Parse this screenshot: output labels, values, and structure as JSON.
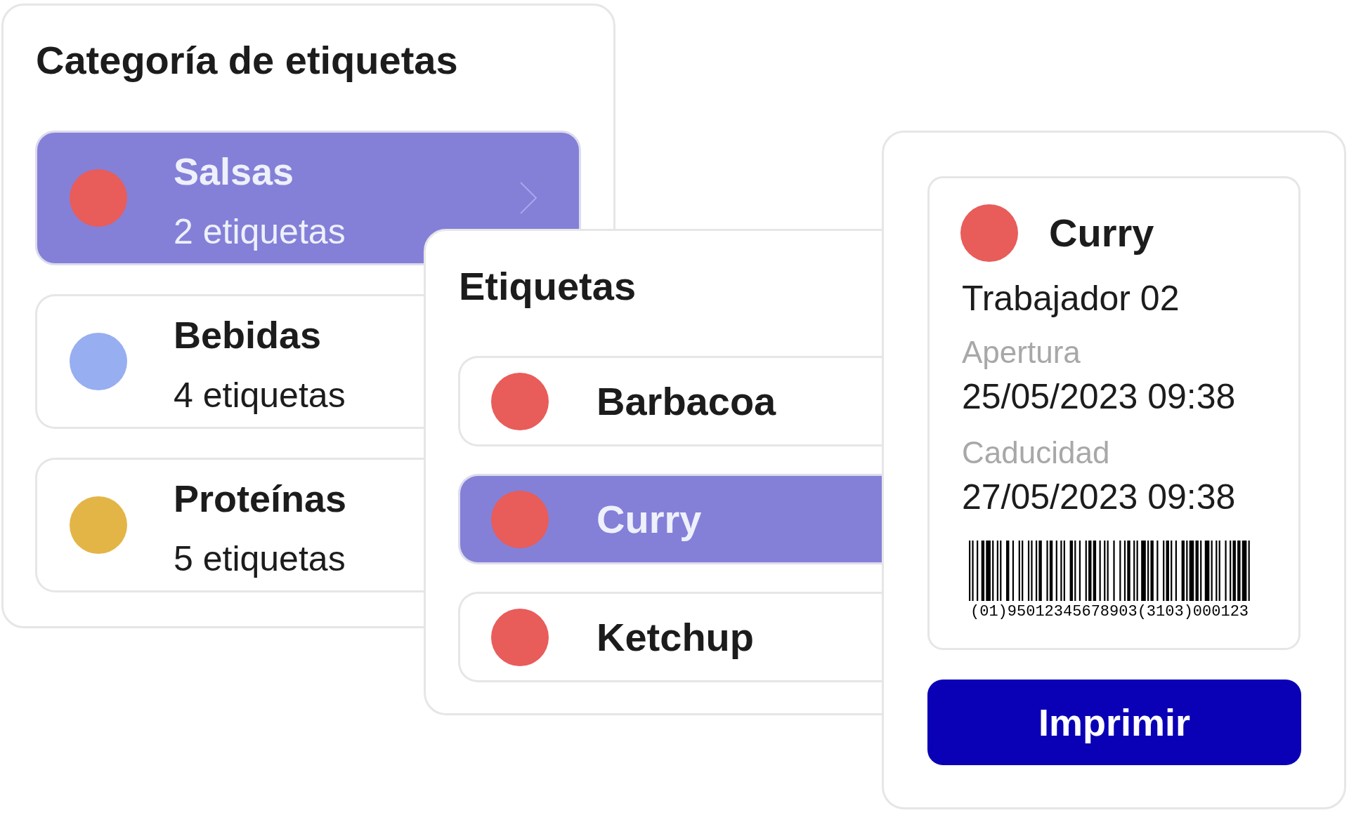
{
  "categories_panel": {
    "title": "Categoría de etiquetas",
    "items": [
      {
        "name": "Salsas",
        "count": "2 etiquetas",
        "color": "#e85c5a",
        "selected": true
      },
      {
        "name": "Bebidas",
        "count": "4 etiquetas",
        "color": "#97aef0",
        "selected": false
      },
      {
        "name": "Proteínas",
        "count": "5 etiquetas",
        "color": "#e3b547",
        "selected": false
      }
    ]
  },
  "labels_panel": {
    "title": "Etiquetas",
    "items": [
      {
        "name": "Barbacoa",
        "selected": false
      },
      {
        "name": "Curry",
        "selected": true
      },
      {
        "name": "Ketchup",
        "selected": false
      }
    ]
  },
  "label_preview": {
    "name": "Curry",
    "worker": "Trabajador 02",
    "fields": [
      {
        "label": "Apertura",
        "value": "25/05/2023 09:38"
      },
      {
        "label": "Caducidad",
        "value": "27/05/2023 09:38"
      }
    ],
    "barcode_number": "(01)95012345678903(3103)000123"
  },
  "print_button": "Imprimir"
}
